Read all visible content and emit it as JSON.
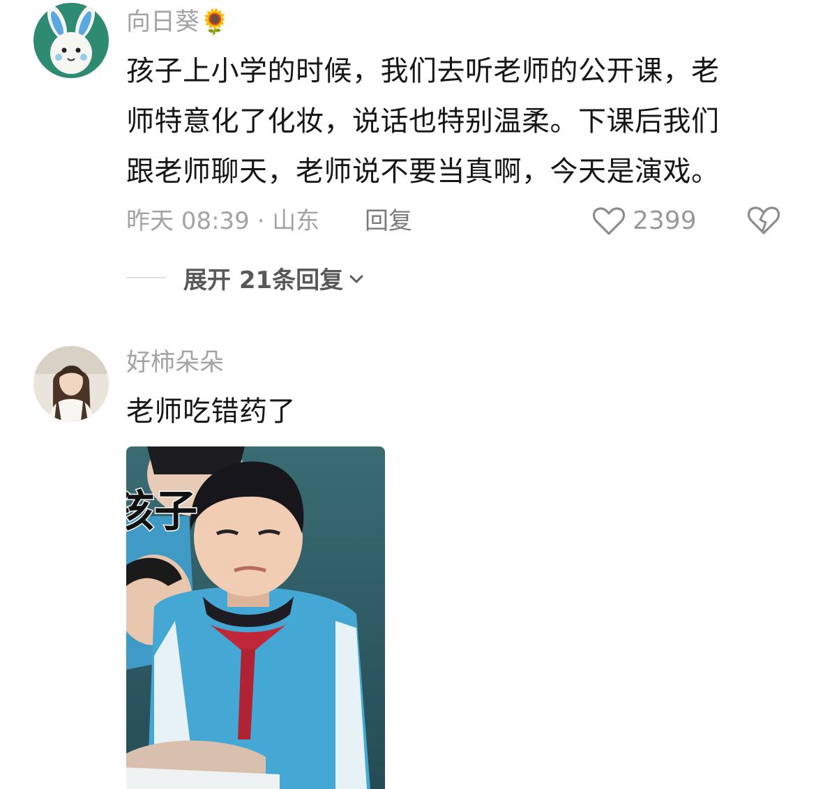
{
  "comments": [
    {
      "username": "向日葵🌻",
      "lines": [
        "孩子上小学的时候，我们去听老师的公开课，老",
        "师特意化了化妆，说话也特别温柔。下课后我们",
        "跟老师聊天，老师说不要当真啊，今天是演戏。"
      ],
      "time_location": "昨天 08:39 · 山东",
      "reply_label": "回复",
      "like_count": "2399",
      "expand_label": "展开 21条回复"
    },
    {
      "username": "好柿朵朵",
      "lines": [
        "老师吃错药了"
      ],
      "image_caption": "孩子"
    }
  ],
  "icons": {
    "like": "heart-outline-icon",
    "dislike": "broken-heart-icon",
    "expand": "chevron-down-icon"
  },
  "colors": {
    "meta_gray": "#a3a3a3",
    "text": "#161616",
    "uniform_blue": "#3fa2cf",
    "scarf_red": "#c0283a"
  }
}
